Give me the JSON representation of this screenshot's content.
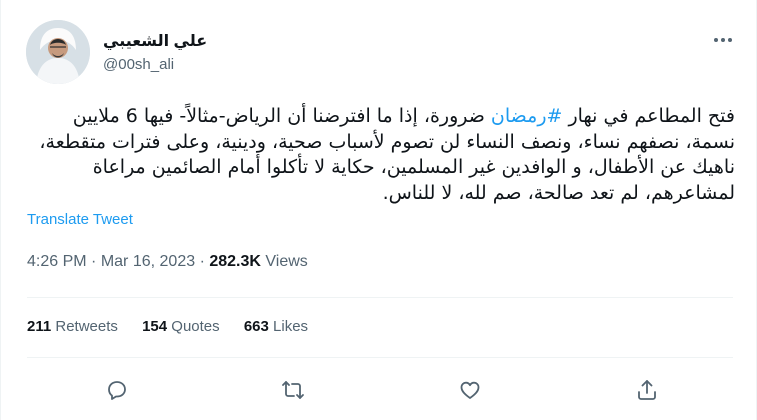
{
  "author": {
    "name": "علي الشعيبي",
    "handle": "@00sh_ali"
  },
  "tweet": {
    "hashtag": "#رمضان",
    "text_before": "فتح المطاعم في نهار ",
    "text_after": " ضرورة، إذا ما افترضنا أن الرياض-مثالاً- فيها 6 ملايين نسمة، نصفهم نساء، ونصف النساء لن تصوم لأسباب صحية، ودينية، وعلى فترات متقطعة، ناهيك عن الأطفال، و الوافدين غير المسلمين، حكاية لا تأكلوا أمام الصائمين مراعاة لمشاعرهم، لم تعد صالحة، صم لله، لا للناس.",
    "translate_label": "Translate Tweet"
  },
  "meta": {
    "time": "4:26 PM",
    "date": "Mar 16, 2023",
    "views_count": "282.3K",
    "views_label": "Views"
  },
  "stats": {
    "retweets_count": "211",
    "retweets_label": "Retweets",
    "quotes_count": "154",
    "quotes_label": "Quotes",
    "likes_count": "663",
    "likes_label": "Likes"
  },
  "icons": {
    "more": "more-horizontal-icon",
    "reply": "reply-icon",
    "retweet": "retweet-icon",
    "like": "like-icon",
    "share": "share-icon"
  },
  "colors": {
    "accent": "#1d9bf0",
    "text": "#0f1419",
    "secondary": "#536471",
    "border": "#eff3f4"
  }
}
